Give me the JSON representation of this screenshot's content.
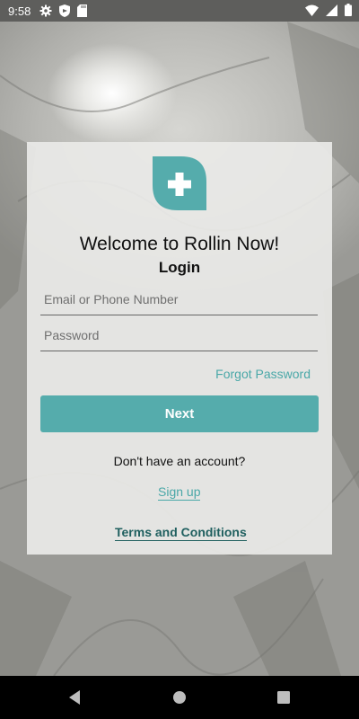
{
  "status_bar": {
    "time": "9:58",
    "left_icons": [
      "gear-icon",
      "shield-icon",
      "sd-card-icon"
    ],
    "right_icons": [
      "wifi-icon",
      "cellular-icon",
      "battery-icon"
    ]
  },
  "login": {
    "logo_icon": "plus-leaf-logo",
    "welcome": "Welcome to Rollin Now!",
    "title": "Login",
    "email_placeholder": "Email or Phone Number",
    "password_placeholder": "Password",
    "forgot_password": "Forgot Password",
    "next_button": "Next",
    "no_account_text": "Don't have an account?",
    "signup_link": "Sign up",
    "terms_link": "Terms and Conditions"
  },
  "nav_bar": {
    "buttons": [
      "back-icon",
      "home-icon",
      "recents-icon"
    ]
  },
  "colors": {
    "accent": "#55acac",
    "link": "#4aa8a8",
    "terms": "#1f5f5f",
    "status_bar": "#5e5e5c",
    "nav_bar": "#000000"
  }
}
